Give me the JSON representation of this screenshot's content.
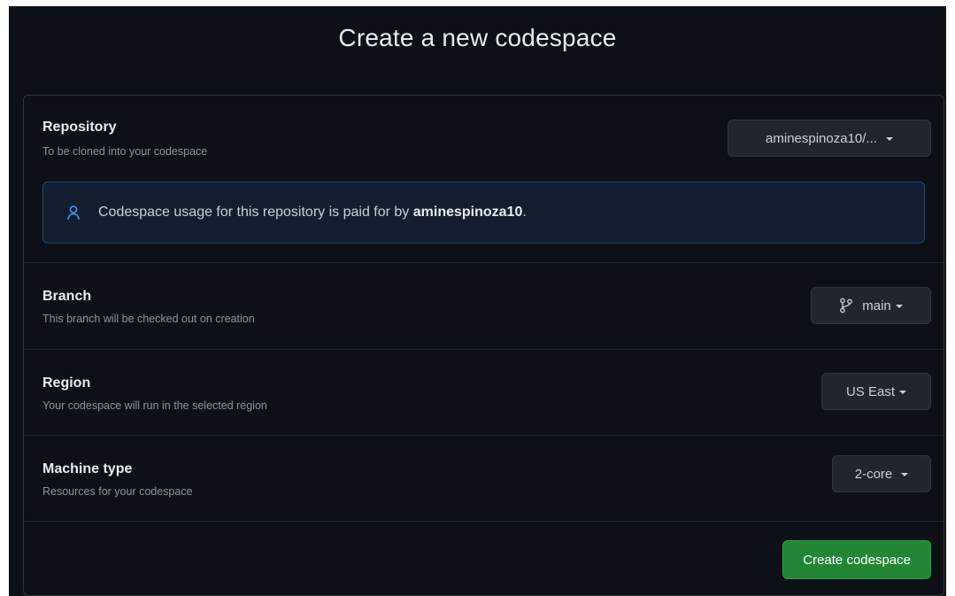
{
  "page": {
    "title": "Create a new codespace"
  },
  "repository": {
    "title": "Repository",
    "description": "To be cloned into your codespace",
    "selected": "aminespinoza10/...",
    "notice_prefix": "Codespace usage for this repository is paid for by ",
    "notice_owner": "aminespinoza10",
    "notice_suffix": "."
  },
  "branch": {
    "title": "Branch",
    "description": "This branch will be checked out on creation",
    "selected": "main"
  },
  "region": {
    "title": "Region",
    "description": "Your codespace will run in the selected region",
    "selected": "US East"
  },
  "machine": {
    "title": "Machine type",
    "description": "Resources for your codespace",
    "selected": "2-core"
  },
  "actions": {
    "create_label": "Create codespace"
  },
  "icons": {
    "notice": "person-icon",
    "branch": "git-branch-icon",
    "dropdown": "caret-down-icon"
  },
  "colors": {
    "background": "#0d1117",
    "border": "#30363d",
    "notice_bg": "#121d2f",
    "notice_border": "#1f4478",
    "accent_blue": "#4493f8",
    "primary_green": "#238636"
  }
}
